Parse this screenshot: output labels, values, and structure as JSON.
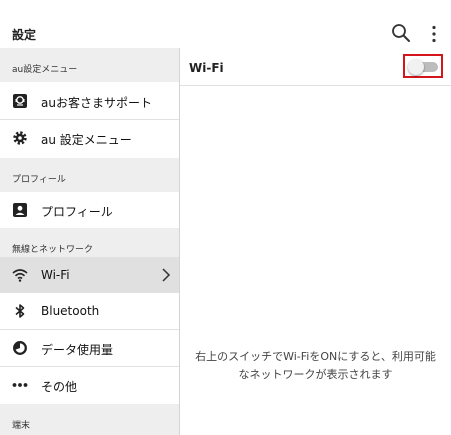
{
  "app": {
    "title": "設定"
  },
  "sidebar": {
    "sections": [
      {
        "header": "au設定メニュー"
      },
      {
        "header": "プロフィール"
      },
      {
        "header": "無線とネットワーク"
      },
      {
        "header": "端末"
      }
    ],
    "items": [
      {
        "label": "auお客さまサポート",
        "icon": "support-icon"
      },
      {
        "label": "au 設定メニュー",
        "icon": "gear-icon"
      },
      {
        "label": "プロフィール",
        "icon": "profile-icon"
      },
      {
        "label": "Wi-Fi",
        "icon": "wifi-icon",
        "selected": true
      },
      {
        "label": "Bluetooth",
        "icon": "bluetooth-icon"
      },
      {
        "label": "データ使用量",
        "icon": "data-usage-icon"
      },
      {
        "label": "その他",
        "icon": "more-horiz-icon"
      }
    ]
  },
  "content": {
    "title": "Wi-Fi",
    "toggle_state": "off",
    "hint_line1": "右上のスイッチでWi-FiをONにすると、利用可能",
    "hint_line2": "なネットワークが表示されます"
  },
  "colors": {
    "highlight_border": "#d4161c",
    "selected_bg": "#e0e0e0",
    "section_bg": "#eeeeee"
  }
}
